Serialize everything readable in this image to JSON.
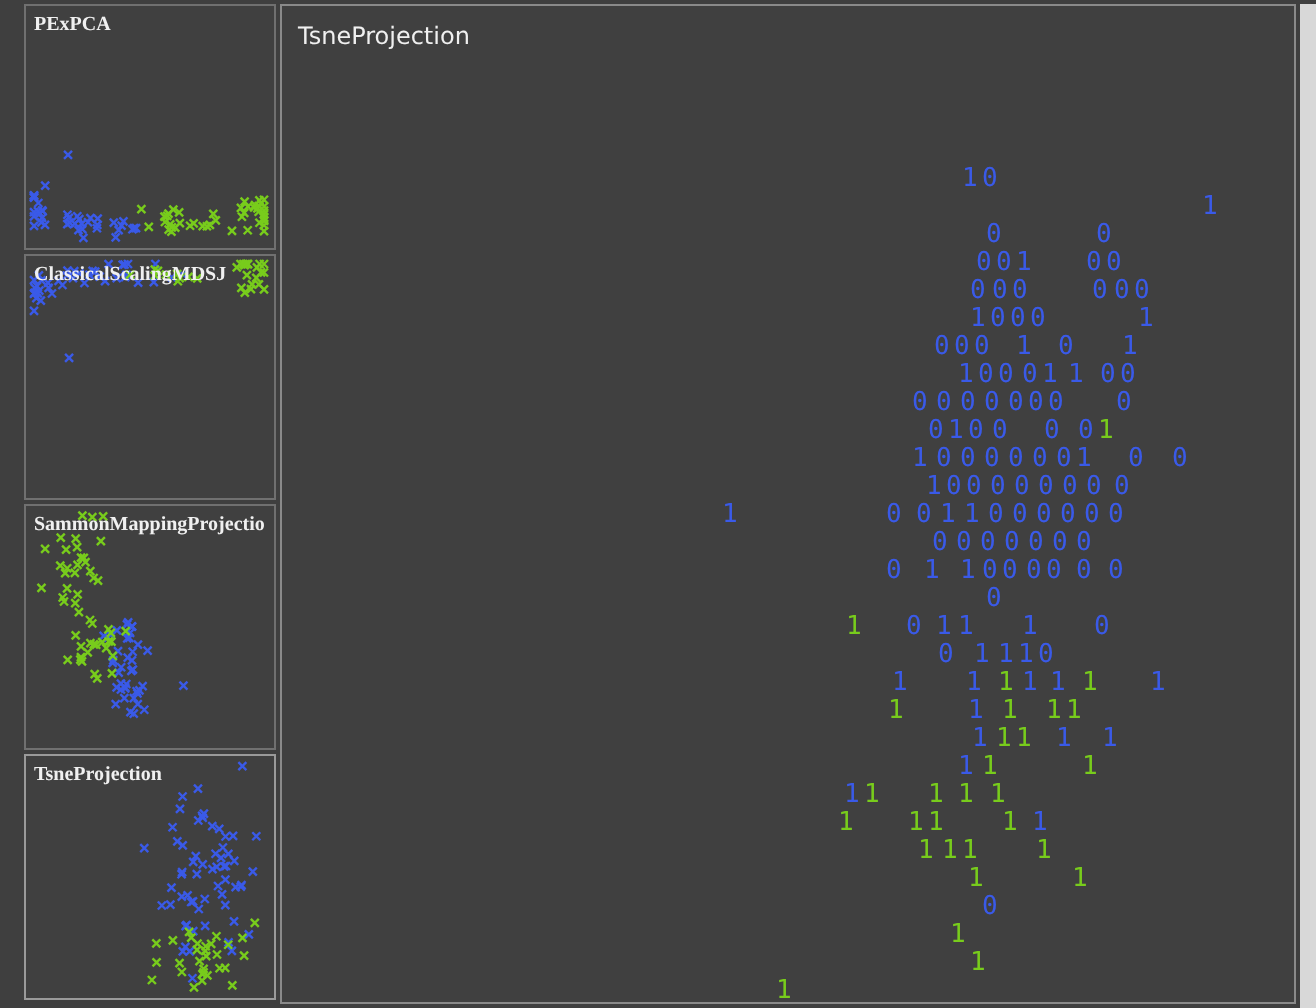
{
  "projections": [
    {
      "title": "PExPCA",
      "selected": false
    },
    {
      "title": "ClassicalScalingMDSJ",
      "selected": false
    },
    {
      "title": "SammonMappingProjectio",
      "selected": false
    },
    {
      "title": "TsneProjection",
      "selected": true
    }
  ],
  "classes": [
    {
      "color": "#3a5ae8"
    },
    {
      "color": "#78cc1c"
    }
  ],
  "main": {
    "title": "TsneProjection",
    "points": [
      {
        "label": "1",
        "color": "#3a5ae8"
      },
      {
        "label": "0",
        "color": "#3a5ae8"
      },
      {
        "label": "1",
        "color": "#3a5ae8"
      },
      {
        "label": "0",
        "color": "#3a5ae8"
      },
      {
        "label": "0",
        "color": "#3a5ae8"
      },
      {
        "label": "0",
        "color": "#3a5ae8"
      },
      {
        "label": "0",
        "color": "#3a5ae8"
      },
      {
        "label": "1",
        "color": "#3a5ae8"
      },
      {
        "label": "0",
        "color": "#3a5ae8"
      },
      {
        "label": "0",
        "color": "#3a5ae8"
      },
      {
        "label": "0",
        "color": "#3a5ae8"
      },
      {
        "label": "0",
        "color": "#3a5ae8"
      },
      {
        "label": "0",
        "color": "#3a5ae8"
      },
      {
        "label": "0",
        "color": "#3a5ae8"
      },
      {
        "label": "0",
        "color": "#3a5ae8"
      },
      {
        "label": "0",
        "color": "#3a5ae8"
      },
      {
        "label": "1",
        "color": "#3a5ae8"
      },
      {
        "label": "0",
        "color": "#3a5ae8"
      },
      {
        "label": "0",
        "color": "#3a5ae8"
      },
      {
        "label": "0",
        "color": "#3a5ae8"
      },
      {
        "label": "1",
        "color": "#3a5ae8"
      },
      {
        "label": "0",
        "color": "#3a5ae8"
      },
      {
        "label": "0",
        "color": "#3a5ae8"
      },
      {
        "label": "0",
        "color": "#3a5ae8"
      },
      {
        "label": "1",
        "color": "#3a5ae8"
      },
      {
        "label": "0",
        "color": "#3a5ae8"
      },
      {
        "label": "1",
        "color": "#3a5ae8"
      },
      {
        "label": "1",
        "color": "#3a5ae8"
      },
      {
        "label": "0",
        "color": "#3a5ae8"
      },
      {
        "label": "0",
        "color": "#3a5ae8"
      },
      {
        "label": "0",
        "color": "#3a5ae8"
      },
      {
        "label": "1",
        "color": "#3a5ae8"
      },
      {
        "label": "1",
        "color": "#3a5ae8"
      },
      {
        "label": "0",
        "color": "#3a5ae8"
      },
      {
        "label": "0",
        "color": "#3a5ae8"
      },
      {
        "label": "0",
        "color": "#3a5ae8"
      },
      {
        "label": "0",
        "color": "#3a5ae8"
      },
      {
        "label": "0",
        "color": "#3a5ae8"
      },
      {
        "label": "0",
        "color": "#3a5ae8"
      },
      {
        "label": "0",
        "color": "#3a5ae8"
      },
      {
        "label": "0",
        "color": "#3a5ae8"
      },
      {
        "label": "0",
        "color": "#3a5ae8"
      },
      {
        "label": "0",
        "color": "#3a5ae8"
      },
      {
        "label": "0",
        "color": "#3a5ae8"
      },
      {
        "label": "1",
        "color": "#3a5ae8"
      },
      {
        "label": "0",
        "color": "#3a5ae8"
      },
      {
        "label": "0",
        "color": "#3a5ae8"
      },
      {
        "label": "0",
        "color": "#3a5ae8"
      },
      {
        "label": "0",
        "color": "#3a5ae8"
      },
      {
        "label": "1",
        "color": "#78cc1c"
      },
      {
        "label": "1",
        "color": "#3a5ae8"
      },
      {
        "label": "0",
        "color": "#3a5ae8"
      },
      {
        "label": "0",
        "color": "#3a5ae8"
      },
      {
        "label": "0",
        "color": "#3a5ae8"
      },
      {
        "label": "0",
        "color": "#3a5ae8"
      },
      {
        "label": "0",
        "color": "#3a5ae8"
      },
      {
        "label": "0",
        "color": "#3a5ae8"
      },
      {
        "label": "1",
        "color": "#3a5ae8"
      },
      {
        "label": "0",
        "color": "#3a5ae8"
      },
      {
        "label": "0",
        "color": "#3a5ae8"
      },
      {
        "label": "1",
        "color": "#3a5ae8"
      },
      {
        "label": "0",
        "color": "#3a5ae8"
      },
      {
        "label": "0",
        "color": "#3a5ae8"
      },
      {
        "label": "0",
        "color": "#3a5ae8"
      },
      {
        "label": "0",
        "color": "#3a5ae8"
      },
      {
        "label": "0",
        "color": "#3a5ae8"
      },
      {
        "label": "0",
        "color": "#3a5ae8"
      },
      {
        "label": "0",
        "color": "#3a5ae8"
      },
      {
        "label": "0",
        "color": "#3a5ae8"
      },
      {
        "label": "1",
        "color": "#3a5ae8"
      },
      {
        "label": "0",
        "color": "#3a5ae8"
      },
      {
        "label": "0",
        "color": "#3a5ae8"
      },
      {
        "label": "1",
        "color": "#3a5ae8"
      },
      {
        "label": "1",
        "color": "#3a5ae8"
      },
      {
        "label": "0",
        "color": "#3a5ae8"
      },
      {
        "label": "0",
        "color": "#3a5ae8"
      },
      {
        "label": "0",
        "color": "#3a5ae8"
      },
      {
        "label": "0",
        "color": "#3a5ae8"
      },
      {
        "label": "0",
        "color": "#3a5ae8"
      },
      {
        "label": "0",
        "color": "#3a5ae8"
      },
      {
        "label": "0",
        "color": "#3a5ae8"
      },
      {
        "label": "0",
        "color": "#3a5ae8"
      },
      {
        "label": "0",
        "color": "#3a5ae8"
      },
      {
        "label": "0",
        "color": "#3a5ae8"
      },
      {
        "label": "0",
        "color": "#3a5ae8"
      },
      {
        "label": "0",
        "color": "#3a5ae8"
      },
      {
        "label": "0",
        "color": "#3a5ae8"
      },
      {
        "label": "0",
        "color": "#3a5ae8"
      },
      {
        "label": "1",
        "color": "#3a5ae8"
      },
      {
        "label": "1",
        "color": "#3a5ae8"
      },
      {
        "label": "0",
        "color": "#3a5ae8"
      },
      {
        "label": "0",
        "color": "#3a5ae8"
      },
      {
        "label": "0",
        "color": "#3a5ae8"
      },
      {
        "label": "0",
        "color": "#3a5ae8"
      },
      {
        "label": "0",
        "color": "#3a5ae8"
      },
      {
        "label": "0",
        "color": "#3a5ae8"
      },
      {
        "label": "0",
        "color": "#3a5ae8"
      },
      {
        "label": "1",
        "color": "#78cc1c"
      },
      {
        "label": "0",
        "color": "#3a5ae8"
      },
      {
        "label": "1",
        "color": "#3a5ae8"
      },
      {
        "label": "1",
        "color": "#3a5ae8"
      },
      {
        "label": "1",
        "color": "#3a5ae8"
      },
      {
        "label": "0",
        "color": "#3a5ae8"
      },
      {
        "label": "0",
        "color": "#3a5ae8"
      },
      {
        "label": "1",
        "color": "#3a5ae8"
      },
      {
        "label": "1",
        "color": "#3a5ae8"
      },
      {
        "label": "1",
        "color": "#3a5ae8"
      },
      {
        "label": "0",
        "color": "#3a5ae8"
      },
      {
        "label": "1",
        "color": "#3a5ae8"
      },
      {
        "label": "1",
        "color": "#3a5ae8"
      },
      {
        "label": "1",
        "color": "#78cc1c"
      },
      {
        "label": "1",
        "color": "#3a5ae8"
      },
      {
        "label": "1",
        "color": "#3a5ae8"
      },
      {
        "label": "1",
        "color": "#78cc1c"
      },
      {
        "label": "1",
        "color": "#3a5ae8"
      },
      {
        "label": "1",
        "color": "#78cc1c"
      },
      {
        "label": "1",
        "color": "#3a5ae8"
      },
      {
        "label": "1",
        "color": "#78cc1c"
      },
      {
        "label": "1",
        "color": "#78cc1c"
      },
      {
        "label": "1",
        "color": "#78cc1c"
      },
      {
        "label": "1",
        "color": "#3a5ae8"
      },
      {
        "label": "1",
        "color": "#78cc1c"
      },
      {
        "label": "1",
        "color": "#78cc1c"
      },
      {
        "label": "1",
        "color": "#3a5ae8"
      },
      {
        "label": "1",
        "color": "#3a5ae8"
      },
      {
        "label": "1",
        "color": "#3a5ae8"
      },
      {
        "label": "1",
        "color": "#78cc1c"
      },
      {
        "label": "1",
        "color": "#78cc1c"
      },
      {
        "label": "1",
        "color": "#3a5ae8"
      },
      {
        "label": "1",
        "color": "#78cc1c"
      },
      {
        "label": "1",
        "color": "#78cc1c"
      },
      {
        "label": "1",
        "color": "#78cc1c"
      },
      {
        "label": "1",
        "color": "#78cc1c"
      },
      {
        "label": "1",
        "color": "#78cc1c"
      },
      {
        "label": "1",
        "color": "#78cc1c"
      },
      {
        "label": "1",
        "color": "#78cc1c"
      },
      {
        "label": "1",
        "color": "#78cc1c"
      },
      {
        "label": "1",
        "color": "#3a5ae8"
      },
      {
        "label": "1",
        "color": "#78cc1c"
      },
      {
        "label": "1",
        "color": "#78cc1c"
      },
      {
        "label": "1",
        "color": "#78cc1c"
      },
      {
        "label": "1",
        "color": "#78cc1c"
      },
      {
        "label": "1",
        "color": "#78cc1c"
      },
      {
        "label": "1",
        "color": "#78cc1c"
      },
      {
        "label": "0",
        "color": "#3a5ae8"
      },
      {
        "label": "1",
        "color": "#78cc1c"
      },
      {
        "label": "1",
        "color": "#78cc1c"
      },
      {
        "label": "1",
        "color": "#78cc1c"
      }
    ]
  }
}
